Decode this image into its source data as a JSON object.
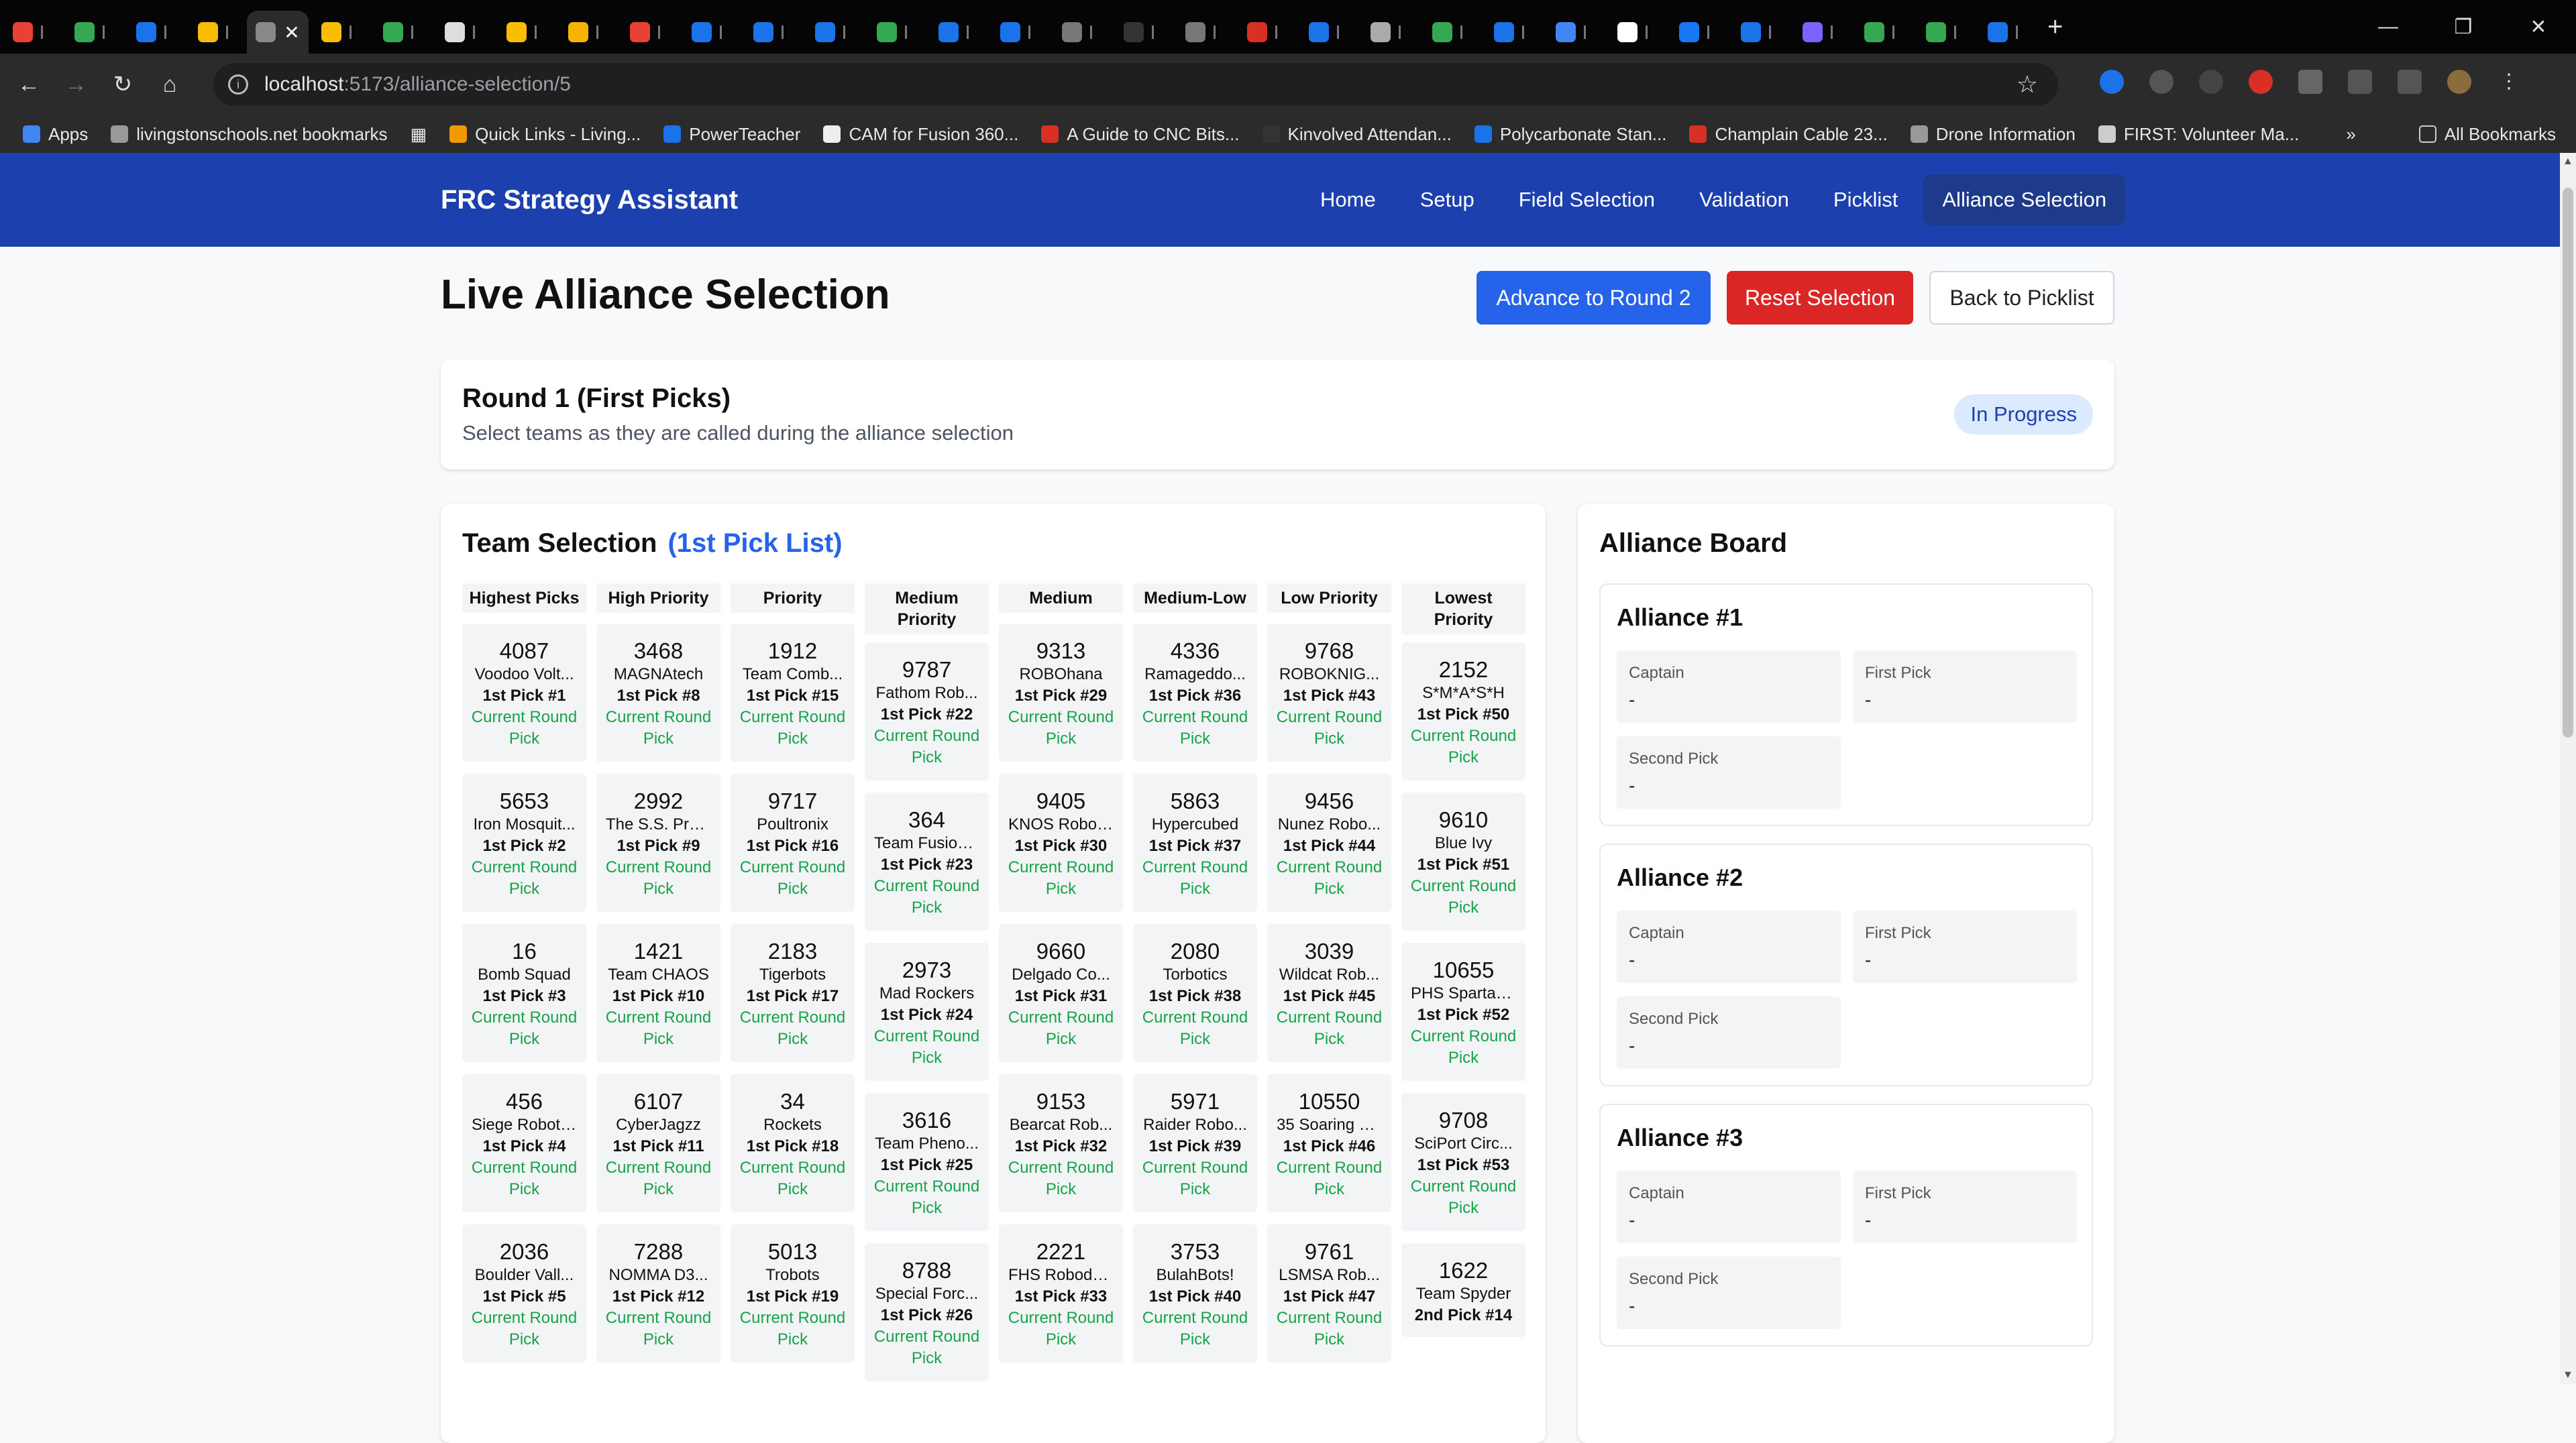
{
  "browser": {
    "url_host": "localhost",
    "url_path": ":5173/alliance-selection/5",
    "tab_count": 33,
    "bookmarks": [
      {
        "label": "Apps",
        "color": "#4285f4"
      },
      {
        "label": "livingstonschools.net bookmarks",
        "color": "#999999"
      },
      {
        "label": "Quick Links - Living...",
        "color": "#f29900"
      },
      {
        "label": "PowerTeacher",
        "color": "#1a73e8"
      },
      {
        "label": "CAM for Fusion 360...",
        "color": "#eeeeee"
      },
      {
        "label": "A Guide to CNC Bits...",
        "color": "#d93025"
      },
      {
        "label": "Kinvolved Attendan...",
        "color": "#333333"
      },
      {
        "label": "Polycarbonate Stan...",
        "color": "#1a73e8"
      },
      {
        "label": "Champlain Cable 23...",
        "color": "#d93025"
      },
      {
        "label": "Drone Information",
        "color": "#999999"
      },
      {
        "label": "FIRST: Volunteer Ma...",
        "color": "#cccccc"
      }
    ],
    "all_bookmarks": "All Bookmarks"
  },
  "app": {
    "brand": "FRC Strategy Assistant",
    "nav": [
      "Home",
      "Setup",
      "Field Selection",
      "Validation",
      "Picklist",
      "Alliance Selection"
    ],
    "active_nav": "Alliance Selection"
  },
  "page": {
    "title": "Live Alliance Selection",
    "advance_button": "Advance to Round 2",
    "reset_button": "Reset Selection",
    "back_button": "Back to Picklist"
  },
  "round": {
    "title": "Round 1 (First Picks)",
    "subtitle": "Select teams as they are called during the alliance selection",
    "status": "In Progress"
  },
  "team_selection": {
    "title": "Team Selection",
    "list_name": "(1st Pick List)",
    "columns": [
      {
        "header": "Highest Picks",
        "teams": [
          {
            "number": "4087",
            "name": "Voodoo Volt...",
            "pick": "1st Pick #1",
            "status": "Current Round Pick"
          },
          {
            "number": "5653",
            "name": "Iron Mosquit...",
            "pick": "1st Pick #2",
            "status": "Current Round Pick"
          },
          {
            "number": "16",
            "name": "Bomb Squad",
            "pick": "1st Pick #3",
            "status": "Current Round Pick"
          },
          {
            "number": "456",
            "name": "Siege Roboti...",
            "pick": "1st Pick #4",
            "status": "Current Round Pick"
          },
          {
            "number": "2036",
            "name": "Boulder Vall...",
            "pick": "1st Pick #5",
            "status": "Current Round Pick"
          }
        ]
      },
      {
        "header": "High Priority",
        "teams": [
          {
            "number": "3468",
            "name": "MAGNAtech",
            "pick": "1st Pick #8",
            "status": "Current Round Pick"
          },
          {
            "number": "2992",
            "name": "The S.S. Pro...",
            "pick": "1st Pick #9",
            "status": "Current Round Pick"
          },
          {
            "number": "1421",
            "name": "Team CHAOS",
            "pick": "1st Pick #10",
            "status": "Current Round Pick"
          },
          {
            "number": "6107",
            "name": "CyberJagzz",
            "pick": "1st Pick #11",
            "status": "Current Round Pick"
          },
          {
            "number": "7288",
            "name": "NOMMA D3...",
            "pick": "1st Pick #12",
            "status": "Current Round Pick"
          }
        ]
      },
      {
        "header": "Priority",
        "teams": [
          {
            "number": "1912",
            "name": "Team Comb...",
            "pick": "1st Pick #15",
            "status": "Current Round Pick"
          },
          {
            "number": "9717",
            "name": "Poultronix",
            "pick": "1st Pick #16",
            "status": "Current Round Pick"
          },
          {
            "number": "2183",
            "name": "Tigerbots",
            "pick": "1st Pick #17",
            "status": "Current Round Pick"
          },
          {
            "number": "34",
            "name": "Rockets",
            "pick": "1st Pick #18",
            "status": "Current Round Pick"
          },
          {
            "number": "5013",
            "name": "Trobots",
            "pick": "1st Pick #19",
            "status": "Current Round Pick"
          }
        ]
      },
      {
        "header": "Medium Priority",
        "teams": [
          {
            "number": "9787",
            "name": "Fathom Rob...",
            "pick": "1st Pick #22",
            "status": "Current Round Pick"
          },
          {
            "number": "364",
            "name": "Team Fusion...",
            "pick": "1st Pick #23",
            "status": "Current Round Pick"
          },
          {
            "number": "2973",
            "name": "Mad Rockers",
            "pick": "1st Pick #24",
            "status": "Current Round Pick"
          },
          {
            "number": "3616",
            "name": "Team Pheno...",
            "pick": "1st Pick #25",
            "status": "Current Round Pick"
          },
          {
            "number": "8788",
            "name": "Special Forc...",
            "pick": "1st Pick #26",
            "status": "Current Round Pick"
          }
        ]
      },
      {
        "header": "Medium",
        "teams": [
          {
            "number": "9313",
            "name": "ROBOhana",
            "pick": "1st Pick #29",
            "status": "Current Round Pick"
          },
          {
            "number": "9405",
            "name": "KNOS Robot...",
            "pick": "1st Pick #30",
            "status": "Current Round Pick"
          },
          {
            "number": "9660",
            "name": "Delgado Co...",
            "pick": "1st Pick #31",
            "status": "Current Round Pick"
          },
          {
            "number": "9153",
            "name": "Bearcat Rob...",
            "pick": "1st Pick #32",
            "status": "Current Round Pick"
          },
          {
            "number": "2221",
            "name": "FHS Roboda...",
            "pick": "1st Pick #33",
            "status": "Current Round Pick"
          }
        ]
      },
      {
        "header": "Medium-Low",
        "teams": [
          {
            "number": "4336",
            "name": "Ramageddo...",
            "pick": "1st Pick #36",
            "status": "Current Round Pick"
          },
          {
            "number": "5863",
            "name": "Hypercubed",
            "pick": "1st Pick #37",
            "status": "Current Round Pick"
          },
          {
            "number": "2080",
            "name": "Torbotics",
            "pick": "1st Pick #38",
            "status": "Current Round Pick"
          },
          {
            "number": "5971",
            "name": "Raider Robo...",
            "pick": "1st Pick #39",
            "status": "Current Round Pick"
          },
          {
            "number": "3753",
            "name": "BulahBots!",
            "pick": "1st Pick #40",
            "status": "Current Round Pick"
          }
        ]
      },
      {
        "header": "Low Priority",
        "teams": [
          {
            "number": "9768",
            "name": "ROBOKNIG...",
            "pick": "1st Pick #43",
            "status": "Current Round Pick"
          },
          {
            "number": "9456",
            "name": "Nunez Robo...",
            "pick": "1st Pick #44",
            "status": "Current Round Pick"
          },
          {
            "number": "3039",
            "name": "Wildcat Rob...",
            "pick": "1st Pick #45",
            "status": "Current Round Pick"
          },
          {
            "number": "10550",
            "name": "35 Soaring R...",
            "pick": "1st Pick #46",
            "status": "Current Round Pick"
          },
          {
            "number": "9761",
            "name": "LSMSA Rob...",
            "pick": "1st Pick #47",
            "status": "Current Round Pick"
          }
        ]
      },
      {
        "header": "Lowest Priority",
        "teams": [
          {
            "number": "2152",
            "name": "S*M*A*S*H",
            "pick": "1st Pick #50",
            "status": "Current Round Pick"
          },
          {
            "number": "9610",
            "name": "Blue Ivy",
            "pick": "1st Pick #51",
            "status": "Current Round Pick"
          },
          {
            "number": "10655",
            "name": "PHS Spartan...",
            "pick": "1st Pick #52",
            "status": "Current Round Pick"
          },
          {
            "number": "9708",
            "name": "SciPort Circ...",
            "pick": "1st Pick #53",
            "status": "Current Round Pick"
          },
          {
            "number": "1622",
            "name": "Team Spyder",
            "pick": "2nd Pick #14",
            "status": ""
          }
        ]
      }
    ]
  },
  "alliance_board": {
    "title": "Alliance Board",
    "alliances": [
      {
        "name": "Alliance #1",
        "captain_label": "Captain",
        "captain": "-",
        "first_label": "First Pick",
        "first": "-",
        "second_label": "Second Pick",
        "second": "-"
      },
      {
        "name": "Alliance #2",
        "captain_label": "Captain",
        "captain": "-",
        "first_label": "First Pick",
        "first": "-",
        "second_label": "Second Pick",
        "second": "-"
      },
      {
        "name": "Alliance #3",
        "captain_label": "Captain",
        "captain": "-",
        "first_label": "First Pick",
        "first": "-",
        "second_label": "Second Pick",
        "second": "-"
      }
    ]
  }
}
